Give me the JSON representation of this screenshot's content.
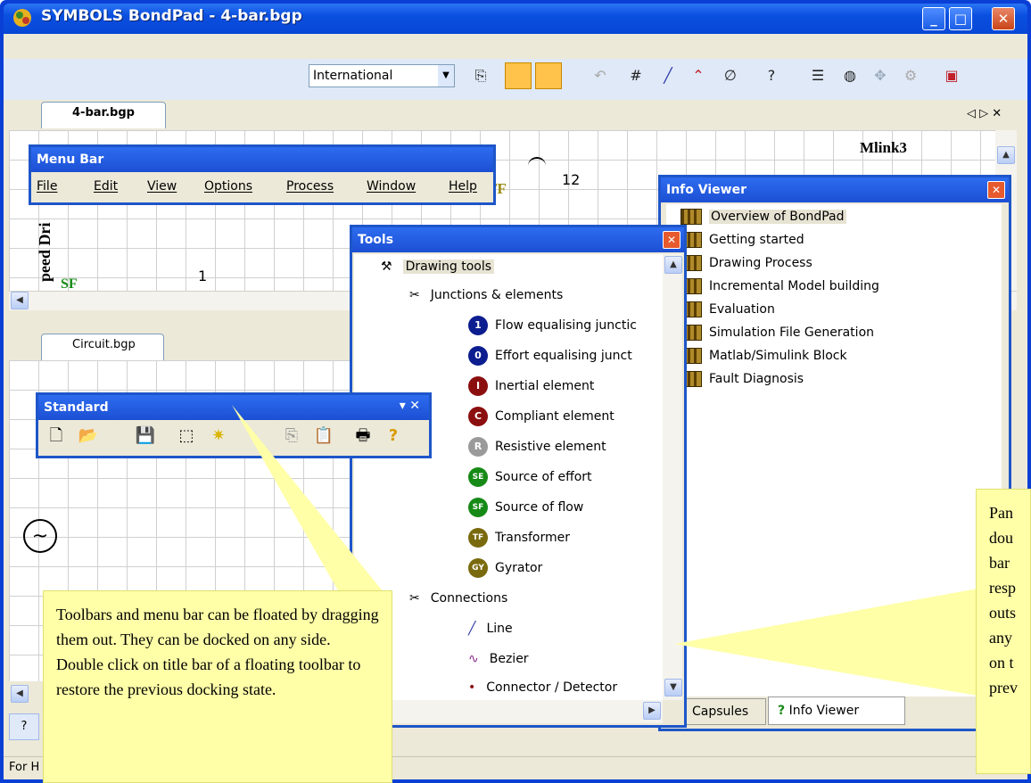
{
  "window": {
    "title": "SYMBOLS BondPad - 4-bar.bgp",
    "minimize": "_",
    "maximize": "□",
    "close": "✕"
  },
  "toolbar": {
    "locale_value": "International",
    "icons": [
      "copy-icon",
      "grid-icon",
      "snap-grid-icon",
      "undo-icon",
      "hash-icon",
      "bond-icon",
      "angle-bond-icon",
      "null-icon",
      "help-icon",
      "list-icon",
      "capsule-icon",
      "process-icon",
      "settings-icon",
      "simulate-icon"
    ]
  },
  "docs": {
    "top_tab": "4-bar.bgp",
    "bottom_tab": "Circuit.bgp",
    "tab_nav": "◁ ▷ ✕",
    "top_labels": {
      "mlink": "Mlink3",
      "num12": "12",
      "tf": "TF",
      "sf": "SF",
      "one": "1",
      "speed": "peed Dri"
    }
  },
  "menu_bar": {
    "title": "Menu Bar",
    "items": [
      "File",
      "Edit",
      "View",
      "Options",
      "Process",
      "Window",
      "Help"
    ]
  },
  "standard_toolbar": {
    "title": "Standard",
    "title_controls": "▾ ✕"
  },
  "tools": {
    "title": "Tools",
    "root": "Drawing tools",
    "group1": "Junctions & elements",
    "elements": [
      {
        "symbol": "1",
        "label": "Flow equalising junctic",
        "color": "#0b1d8f"
      },
      {
        "symbol": "0",
        "label": "Effort equalising junct",
        "color": "#0b1d8f"
      },
      {
        "symbol": "I",
        "label": "Inertial element",
        "color": "#8c0f0f"
      },
      {
        "symbol": "C",
        "label": "Compliant element",
        "color": "#8c0f0f"
      },
      {
        "symbol": "R",
        "label": "Resistive element",
        "color": "#9a9a9a"
      },
      {
        "symbol": "SE",
        "label": "Source of effort",
        "color": "#168a16"
      },
      {
        "symbol": "SF",
        "label": "Source of flow",
        "color": "#168a16"
      },
      {
        "symbol": "TF",
        "label": "Transformer",
        "color": "#7a6a0e"
      },
      {
        "symbol": "GY",
        "label": "Gyrator",
        "color": "#7a6a0e"
      }
    ],
    "group2": "Connections",
    "connections": [
      "Line",
      "Bezier",
      "Connector / Detector"
    ]
  },
  "info_viewer": {
    "title": "Info Viewer",
    "items": [
      "Overview of BondPad",
      "Getting started",
      "Drawing Process",
      "Incremental Model building",
      "Evaluation",
      "Simulation File Generation",
      "Matlab/Simulink Block",
      "Fault Diagnosis"
    ],
    "tabs": [
      "Capsules",
      "Info Viewer"
    ]
  },
  "callouts": {
    "left": "Toolbars and menu bar can be floated by dragging them out. They can be docked on any side. Double click on title bar of a floating toolbar to restore the previous docking state.",
    "right_lines": [
      "Pan",
      "dou",
      "bar",
      "resp",
      "outs",
      "any",
      "on t",
      "prev"
    ]
  },
  "status": {
    "text": "For H"
  }
}
